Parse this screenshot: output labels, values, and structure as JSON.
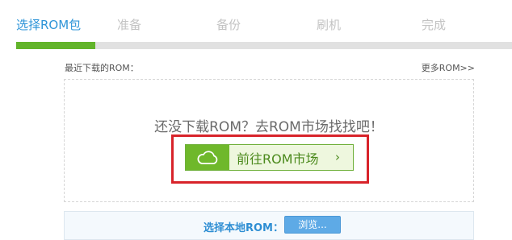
{
  "steps": [
    "选择ROM包",
    "准备",
    "备份",
    "刷机",
    "完成"
  ],
  "active_step": 0,
  "progress": 0.16,
  "recent": {
    "title": "最近下载的ROM：",
    "more_link": "更多ROM>>",
    "empty_message": "还没下载ROM？去ROM市场找找吧！",
    "market_button": "前往ROM市场",
    "market_button_icon": "cloud-icon",
    "chevron": "›"
  },
  "local": {
    "label": "选择本地ROM：",
    "browse_button": "浏览..."
  },
  "colors": {
    "accent": "#2f95d8",
    "progress_fill": "#62b42a",
    "highlight_border": "#d8232a",
    "market_green": "#6fb82b"
  }
}
